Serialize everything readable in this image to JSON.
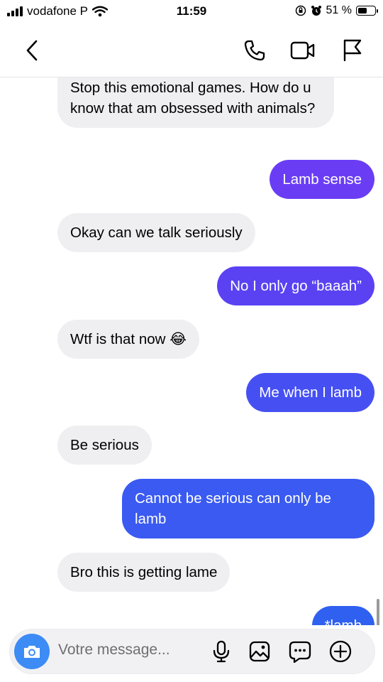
{
  "status_bar": {
    "carrier": "vodafone P",
    "time": "11:59",
    "battery_percent": "51 %"
  },
  "header": {
    "icons": [
      "back-icon",
      "phone-icon",
      "video-icon",
      "flag-icon"
    ]
  },
  "messages": [
    {
      "side": "in",
      "text": "Stop this emotional games. How do u know that am obsessed with animals?"
    },
    {
      "side": "out",
      "text": "Lamb sense"
    },
    {
      "side": "in",
      "text": "Okay can we talk seriously"
    },
    {
      "side": "out",
      "text": "No I only go “baaah”"
    },
    {
      "side": "in",
      "text": "Wtf is that now 😂"
    },
    {
      "side": "out",
      "text": "Me when I lamb"
    },
    {
      "side": "in",
      "text": "Be serious"
    },
    {
      "side": "out",
      "text": "Cannot be serious can only be lamb"
    },
    {
      "side": "in",
      "text": "Bro this is getting lame"
    },
    {
      "side": "out",
      "text": "*lamb"
    }
  ],
  "composer": {
    "placeholder": "Votre message...",
    "icons": [
      "camera-icon",
      "microphone-icon",
      "gallery-icon",
      "sticker-icon",
      "plus-icon"
    ]
  },
  "colors": {
    "outgoing_top": "#6a3df5",
    "outgoing_bottom": "#3060f0",
    "incoming": "#efeff2",
    "camera_button": "#3d8bf5"
  }
}
